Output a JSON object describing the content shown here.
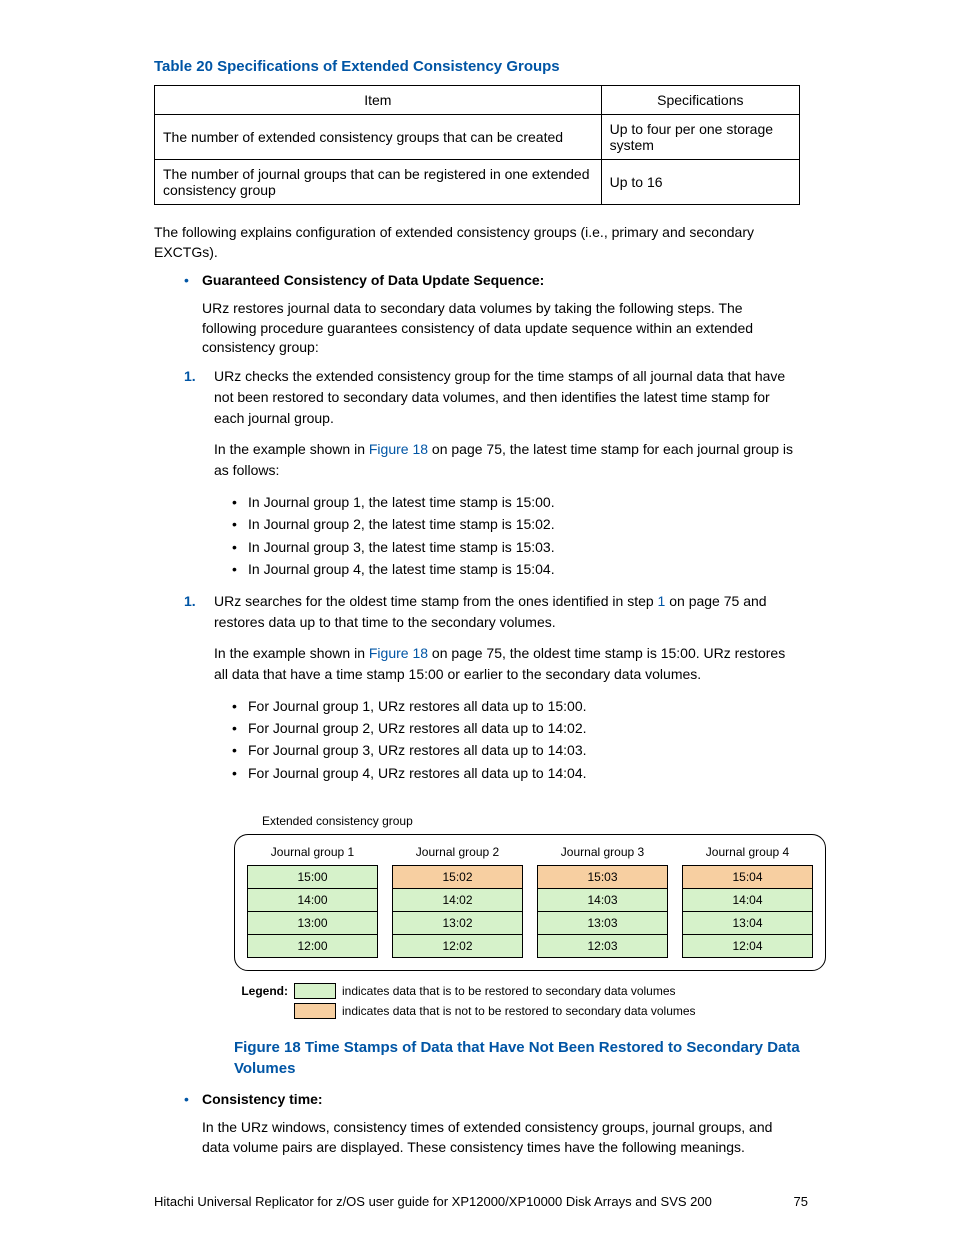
{
  "table_title": "Table 20 Specifications of Extended Consistency Groups",
  "table": {
    "headers": [
      "Item",
      "Specifications"
    ],
    "rows": [
      [
        "The number of extended consistency groups that can be created",
        "Up to four per one storage system"
      ],
      [
        "The number of journal groups that can be registered in one extended consistency group",
        "Up to 16"
      ]
    ]
  },
  "intro": "The following explains configuration of extended consistency groups (i.e., primary and secondary EXCTGs).",
  "b1_title": "Guaranteed Consistency of Data Update Sequence:",
  "b1_body": "URz restores journal data to secondary data volumes by taking the following steps. The following procedure guarantees consistency of data update sequence within an extended consistency group:",
  "step1_a": "URz checks the extended consistency group for the time stamps of all journal data that have not been restored to secondary data volumes, and then identifies the latest time stamp for each journal group.",
  "step1_b1": "In the example shown in ",
  "step1_link": "Figure 18",
  "step1_b2": " on page 75, the latest time stamp for each journal group is as follows:",
  "step1_items": [
    "In Journal group 1, the latest time stamp is 15:00.",
    "In Journal group 2, the latest time stamp is 15:02.",
    "In Journal group 3, the latest time stamp is 15:03.",
    "In Journal group 4, the latest time stamp is 15:04."
  ],
  "step2_a1": "URz searches for the oldest time stamp from the ones identified in step ",
  "step2_link1": "1",
  "step2_a2": " on page 75 and restores data up to that time to the secondary volumes.",
  "step2_b1": "In the example shown in ",
  "step2_link2": "Figure 18",
  "step2_b2": " on page 75, the oldest time stamp is 15:00. URz restores all data that have a time stamp 15:00 or earlier to the secondary data volumes.",
  "step2_items": [
    "For Journal group 1, URz restores all data up to 15:00.",
    "For Journal group 2, URz restores all data up to 14:02.",
    "For Journal group 3, URz restores all data up to 14:03.",
    "For Journal group 4, URz restores all data up to 14:04."
  ],
  "figure": {
    "ecg_label": "Extended consistency group",
    "jgs": [
      {
        "title": "Journal group 1",
        "rows": [
          {
            "v": "15:00",
            "c": "c-green"
          },
          {
            "v": "14:00",
            "c": "c-green"
          },
          {
            "v": "13:00",
            "c": "c-green"
          },
          {
            "v": "12:00",
            "c": "c-green"
          }
        ]
      },
      {
        "title": "Journal group 2",
        "rows": [
          {
            "v": "15:02",
            "c": "c-orange"
          },
          {
            "v": "14:02",
            "c": "c-green"
          },
          {
            "v": "13:02",
            "c": "c-green"
          },
          {
            "v": "12:02",
            "c": "c-green"
          }
        ]
      },
      {
        "title": "Journal group 3",
        "rows": [
          {
            "v": "15:03",
            "c": "c-orange"
          },
          {
            "v": "14:03",
            "c": "c-green"
          },
          {
            "v": "13:03",
            "c": "c-green"
          },
          {
            "v": "12:03",
            "c": "c-green"
          }
        ]
      },
      {
        "title": "Journal group 4",
        "rows": [
          {
            "v": "15:04",
            "c": "c-orange"
          },
          {
            "v": "14:04",
            "c": "c-green"
          },
          {
            "v": "13:04",
            "c": "c-green"
          },
          {
            "v": "12:04",
            "c": "c-green"
          }
        ]
      }
    ],
    "legend_label": "Legend:",
    "legend1": "indicates data that is to be restored to secondary data volumes",
    "legend2": "indicates data that is not to be restored to secondary data volumes",
    "colors": {
      "green": "#d6f2ca",
      "orange": "#f7cfa1"
    }
  },
  "fig_title": "Figure 18 Time Stamps of Data that Have Not Been Restored to Secondary Data Volumes",
  "b2_title": "Consistency time:",
  "b2_body": "In the URz windows, consistency times of extended consistency groups, journal groups, and data volume pairs are displayed. These consistency times have the following meanings.",
  "footer_left": "Hitachi Universal Replicator for z/OS user guide for XP12000/XP10000 Disk Arrays and SVS 200",
  "footer_right": "75"
}
